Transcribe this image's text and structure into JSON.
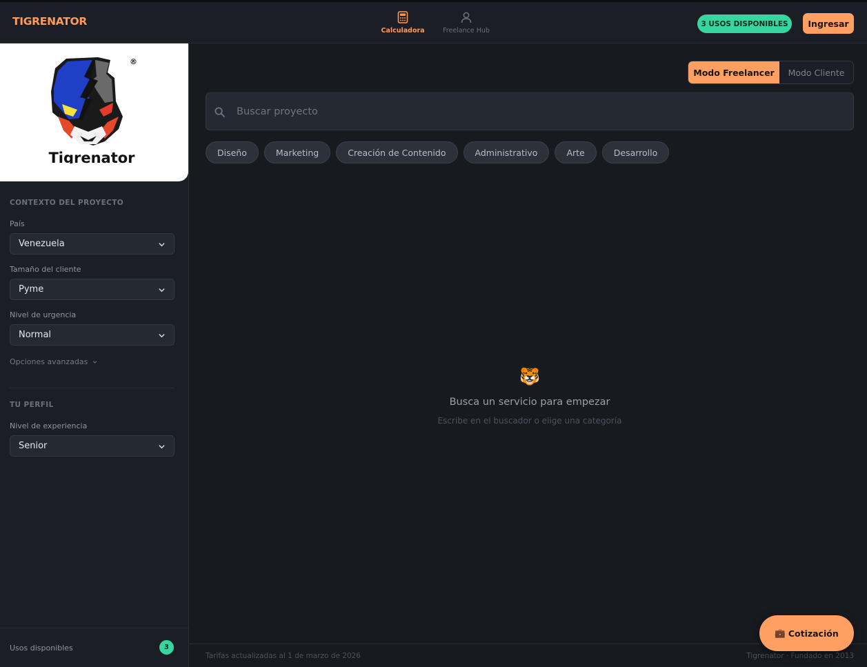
{
  "header": {
    "brand": "TIGRENATOR",
    "nav": [
      {
        "label": "Calculadora",
        "icon": "calculator-icon",
        "active": true
      },
      {
        "label": "Freelance Hub",
        "icon": "user-icon",
        "active": false
      }
    ],
    "uses_badge": "3 USOS DISPONIBLES",
    "login_label": "Ingresar"
  },
  "logo": {
    "text": "Tigrenator",
    "registered": "®"
  },
  "sidebar": {
    "context_title": "CONTEXTO DEL PROYECTO",
    "country": {
      "label": "País",
      "value": "Venezuela"
    },
    "client_size": {
      "label": "Tamaño del cliente",
      "value": "Pyme"
    },
    "urgency": {
      "label": "Nivel de urgencia",
      "value": "Normal"
    },
    "advanced_label": "Opciones avanzadas",
    "profile_title": "TU PERFIL",
    "experience": {
      "label": "Nivel de experiencia",
      "value": "Senior"
    },
    "footer": {
      "uses_label": "Usos disponibles",
      "uses_count": "3"
    }
  },
  "main": {
    "mode": {
      "freelancer": "Modo Freelancer",
      "client": "Modo Cliente",
      "active": "freelancer"
    },
    "search": {
      "placeholder": "Buscar proyecto",
      "value": ""
    },
    "categories": [
      "Diseño",
      "Marketing",
      "Creación de Contenido",
      "Administrativo",
      "Arte",
      "Desarrollo"
    ],
    "empty": {
      "emoji": "🐯",
      "title": "Busca un servicio para empezar",
      "subtitle": "Escribe en el buscador o elige una categoría"
    },
    "quote_button": {
      "emoji": "💼",
      "label": "Cotización"
    },
    "footer": {
      "left": "Tarifas actualizadas al 1 de marzo de 2026",
      "right": "Tigrenator · Fundado en 2013"
    }
  },
  "colors": {
    "accent": "#ffa062",
    "brand": "#ff9a57",
    "success": "#37d6a0",
    "background": "#171a1f",
    "panel": "#1b1e24"
  }
}
